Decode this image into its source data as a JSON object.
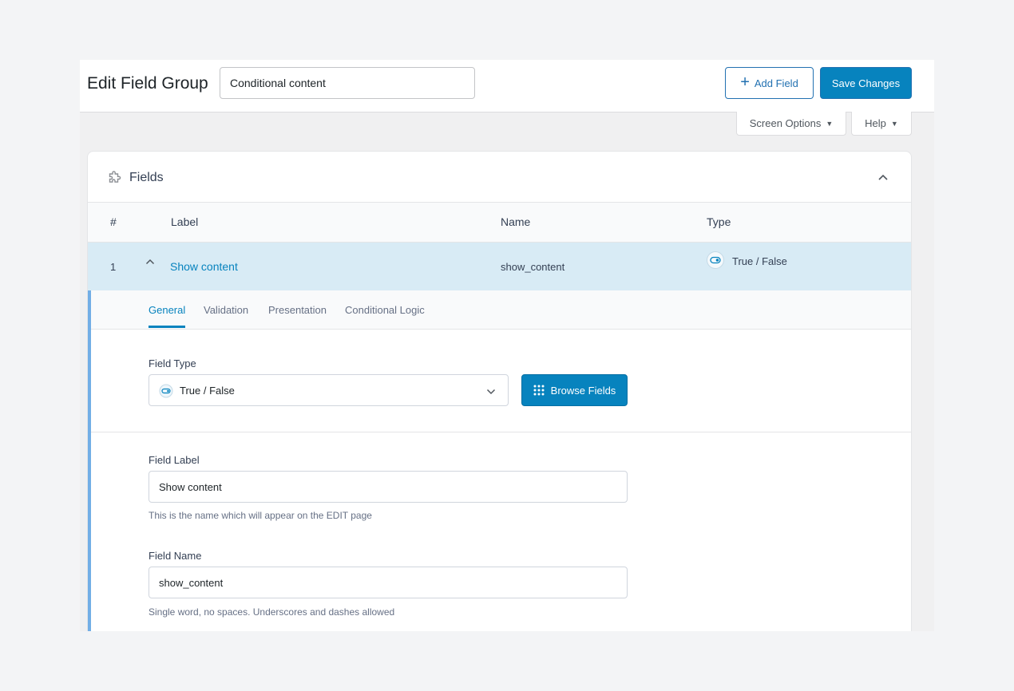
{
  "header": {
    "title": "Edit Field Group",
    "group_title_value": "Conditional content",
    "add_field_label": "Add Field",
    "save_label": "Save Changes"
  },
  "screen_meta": {
    "screen_options_label": "Screen Options",
    "help_label": "Help"
  },
  "panel": {
    "title": "Fields",
    "columns": [
      "#",
      "Label",
      "Name",
      "Type"
    ],
    "rows": [
      {
        "order": "1",
        "label": "Show content",
        "name": "show_content",
        "type": "True / False"
      }
    ]
  },
  "settings": {
    "tabs": [
      "General",
      "Validation",
      "Presentation",
      "Conditional Logic"
    ],
    "active_tab": "General",
    "field_type_label": "Field Type",
    "field_type_value": "True / False",
    "browse_label": "Browse Fields",
    "field_label_label": "Field Label",
    "field_label_value": "Show content",
    "field_label_hint": "This is the name which will appear on the EDIT page",
    "field_name_label": "Field Name",
    "field_name_value": "show_content",
    "field_name_hint": "Single word, no spaces. Underscores and dashes allowed"
  },
  "colors": {
    "primary": "#0783be",
    "row_highlight": "#d8ebf5",
    "left_accent": "#72aee6"
  },
  "icons": [
    "plus-icon",
    "triangle-down-icon",
    "puzzle-icon",
    "chevron-up-icon",
    "toggle-icon",
    "chevron-down-icon",
    "grid-icon"
  ]
}
